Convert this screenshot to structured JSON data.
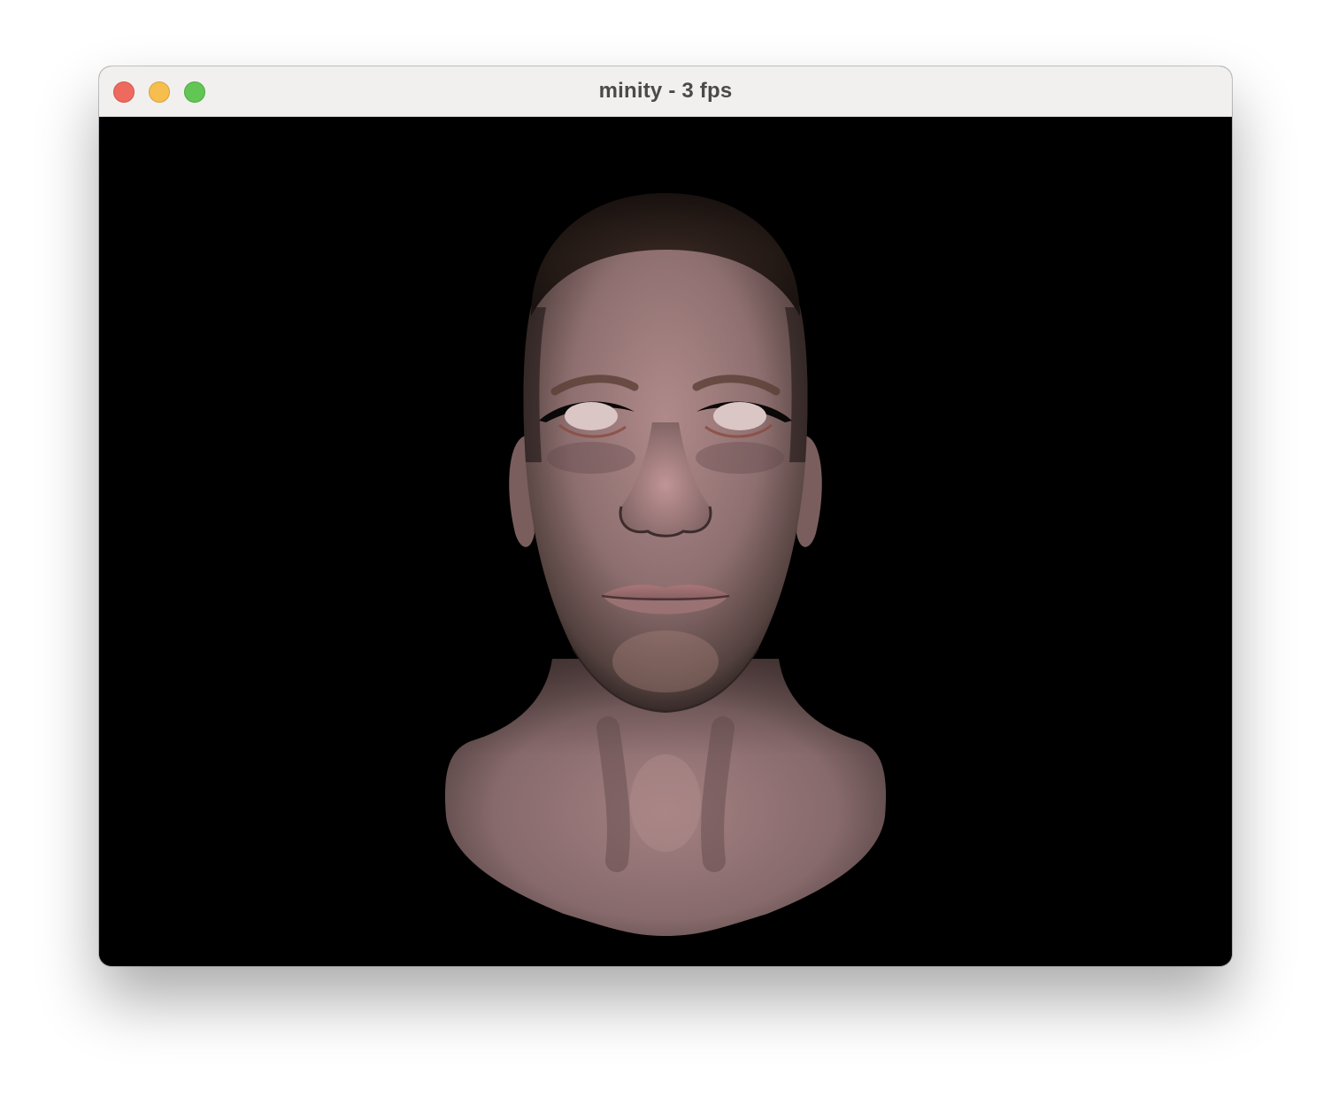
{
  "window": {
    "title": "minity - 3 fps",
    "buttons": [
      "close",
      "minimize",
      "zoom"
    ]
  },
  "viewport": {
    "background": "#000000",
    "content": "rendered-3d-head"
  },
  "colors": {
    "titlebar": "#f1f0ef",
    "close": "#ee6a5e",
    "minimize": "#f6be4f",
    "zoom": "#62c655",
    "skin": "#a37e80",
    "hair": "#2a201d"
  }
}
